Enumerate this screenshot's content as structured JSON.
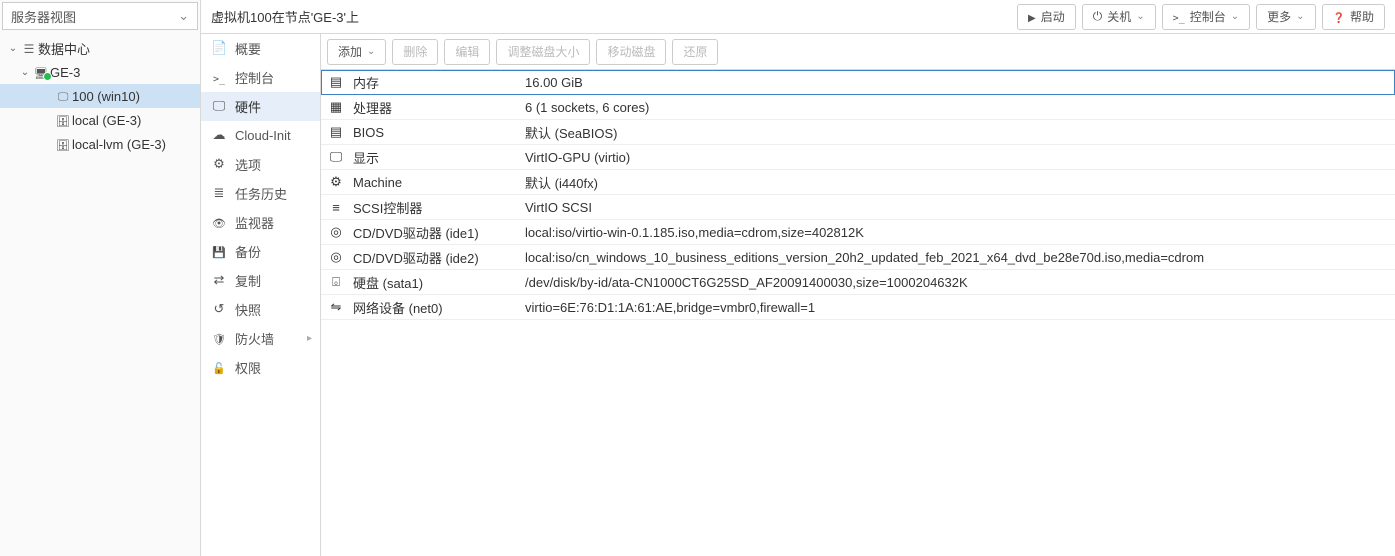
{
  "view_selector": "服务器视图",
  "tree": {
    "datacenter": "数据中心",
    "node": "GE-3",
    "vm": "100 (win10)",
    "storage1": "local (GE-3)",
    "storage2": "local-lvm (GE-3)"
  },
  "topbar": {
    "title": "虚拟机100在节点'GE-3'上",
    "start": "启动",
    "shutdown": "关机",
    "console": "控制台",
    "more": "更多",
    "help": "帮助"
  },
  "subnav": {
    "summary": "概要",
    "console": "控制台",
    "hardware": "硬件",
    "cloudinit": "Cloud-Init",
    "options": "选项",
    "tasks": "任务历史",
    "monitor": "监视器",
    "backup": "备份",
    "replication": "复制",
    "snapshot": "快照",
    "firewall": "防火墙",
    "permissions": "权限"
  },
  "toolbar": {
    "add": "添加",
    "remove": "删除",
    "edit": "编辑",
    "resize": "调整磁盘大小",
    "move": "移动磁盘",
    "revert": "还原"
  },
  "hw": [
    {
      "icon": "i-mem",
      "key": "内存",
      "val": "16.00 GiB",
      "selected": true
    },
    {
      "icon": "i-cpu",
      "key": "处理器",
      "val": "6 (1 sockets, 6 cores)"
    },
    {
      "icon": "i-bios",
      "key": "BIOS",
      "val": "默认 (SeaBIOS)"
    },
    {
      "icon": "i-display",
      "key": "显示",
      "val": "VirtIO-GPU (virtio)"
    },
    {
      "icon": "i-machine",
      "key": "Machine",
      "val": "默认 (i440fx)"
    },
    {
      "icon": "i-scsi",
      "key": "SCSI控制器",
      "val": "VirtIO SCSI"
    },
    {
      "icon": "i-disc",
      "key": "CD/DVD驱动器 (ide1)",
      "val": "local:iso/virtio-win-0.1.185.iso,media=cdrom,size=402812K"
    },
    {
      "icon": "i-disc",
      "key": "CD/DVD驱动器 (ide2)",
      "val": "local:iso/cn_windows_10_business_editions_version_20h2_updated_feb_2021_x64_dvd_be28e70d.iso,media=cdrom"
    },
    {
      "icon": "i-hdd",
      "key": "硬盘 (sata1)",
      "val": "/dev/disk/by-id/ata-CN1000CT6G25SD_AF20091400030,size=1000204632K"
    },
    {
      "icon": "i-net",
      "key": "网络设备 (net0)",
      "val": "virtio=6E:76:D1:1A:61:AE,bridge=vmbr0,firewall=1"
    }
  ]
}
